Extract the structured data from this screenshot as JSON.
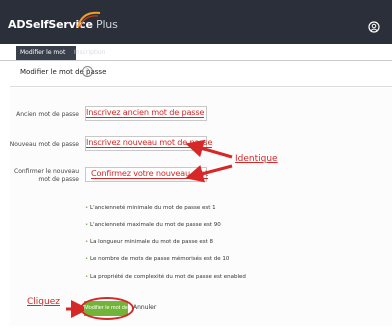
{
  "app": {
    "logo_main": "ADSelfService",
    "logo_plus": " Plus",
    "tabs": [
      "Modifier le mot de passe",
      "Inscription"
    ]
  },
  "page": {
    "title": "Modifier le mot de passe",
    "help_symbol": "?"
  },
  "form": {
    "old_label": "Ancien mot de passe",
    "new_label": "Nouveau mot de passe",
    "confirm_label": "Confirmer le nouveau mot de passe"
  },
  "annotations": {
    "old_hint": "Inscrivez ancien mot de passe",
    "new_hint": "Inscrivez nouveau mot de passe",
    "confirm_hint": "Confirmez votre nouveau mot",
    "identique": "Identique",
    "cliquez": "Cliquez"
  },
  "policy": [
    "L'ancienneté minimale du mot de passe est 1",
    "L'ancienneté maximale du mot de passe est 90",
    "La longueur minimale du mot de passe est 8",
    "Le nombre de mots de passe mémorisés est de 10",
    "La propriété de complexité du mot de passe est enabled"
  ],
  "buttons": {
    "submit": "Modifier le mot de passe",
    "cancel": "Annuler"
  },
  "colors": {
    "header_bg": "#2b2f3a",
    "accent_green": "#71b437",
    "annotation_red": "#d62828"
  }
}
